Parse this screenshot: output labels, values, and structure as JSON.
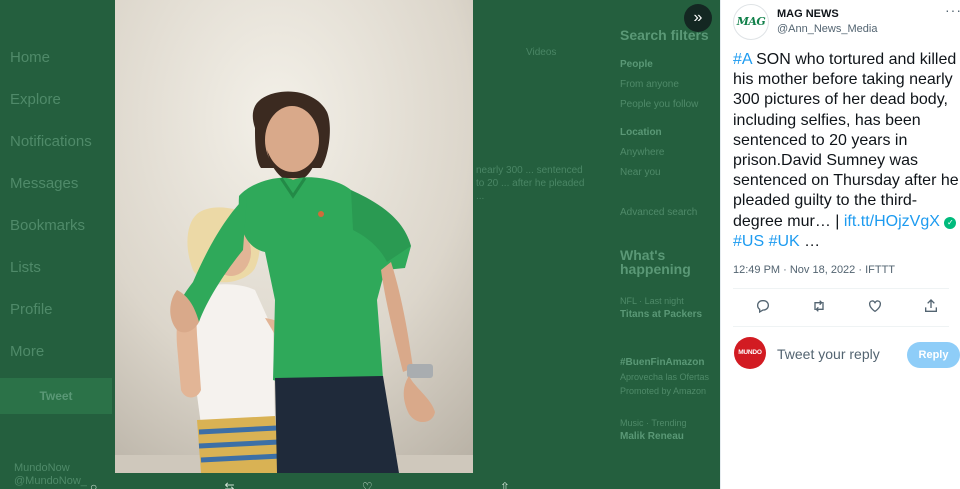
{
  "background": {
    "nav": [
      "Home",
      "Explore",
      "Notifications",
      "Messages",
      "Bookmarks",
      "Lists",
      "Profile",
      "More"
    ],
    "tweet_button": "Tweet",
    "user_name": "MundoNow",
    "user_handle": "@MundoNow_",
    "mid_label": "Videos",
    "mid_snippet": "nearly 300 ... sentenced to 20 ... after he pleaded ...",
    "search_filters": "Search filters",
    "people": "People",
    "from_anyone": "From anyone",
    "people_you_follow": "People you follow",
    "location": "Location",
    "anywhere": "Anywhere",
    "near_you": "Near you",
    "advanced_search": "Advanced search",
    "whats_happening": "What's happening",
    "trend1_meta": "NFL · Last night",
    "trend1": "Titans at Packers",
    "trend2": "#BuenFinAmazon",
    "trend2_sub": "Aprovecha las Ofertas",
    "trend2_promo": "Promoted by Amazon",
    "trend3_meta": "Music · Trending",
    "trend3": "Malik Reneau"
  },
  "tweet": {
    "author_name": "MAG NEWS",
    "author_handle": "@Ann_News_Media",
    "avatar_text": "MAG",
    "more_icon": "···",
    "text_tag": "#A",
    "text_body": " SON who tortured and killed his mother before taking nearly 300 pictures of her dead body, including selfies, has been sentenced to 20 years in prison.David Sumney was sentenced on Thursday after he pleaded guilty to the third-degree mur… | ",
    "link": "ift.tt/HOjzVgX",
    "hashtag_us": "#US",
    "hashtag_uk": "#UK",
    "ellipsis": " …",
    "timestamp": "12:49 PM · Nov 18, 2022 · IFTTT"
  },
  "reply": {
    "avatar_text": "MUNDO",
    "placeholder": "Tweet your reply",
    "button": "Reply"
  },
  "colors": {
    "accent": "#1d9bf0",
    "reply_button": "#8ecdf8",
    "overlay_green": "#1f5b3a",
    "shirt_green": "#2fa95a"
  }
}
